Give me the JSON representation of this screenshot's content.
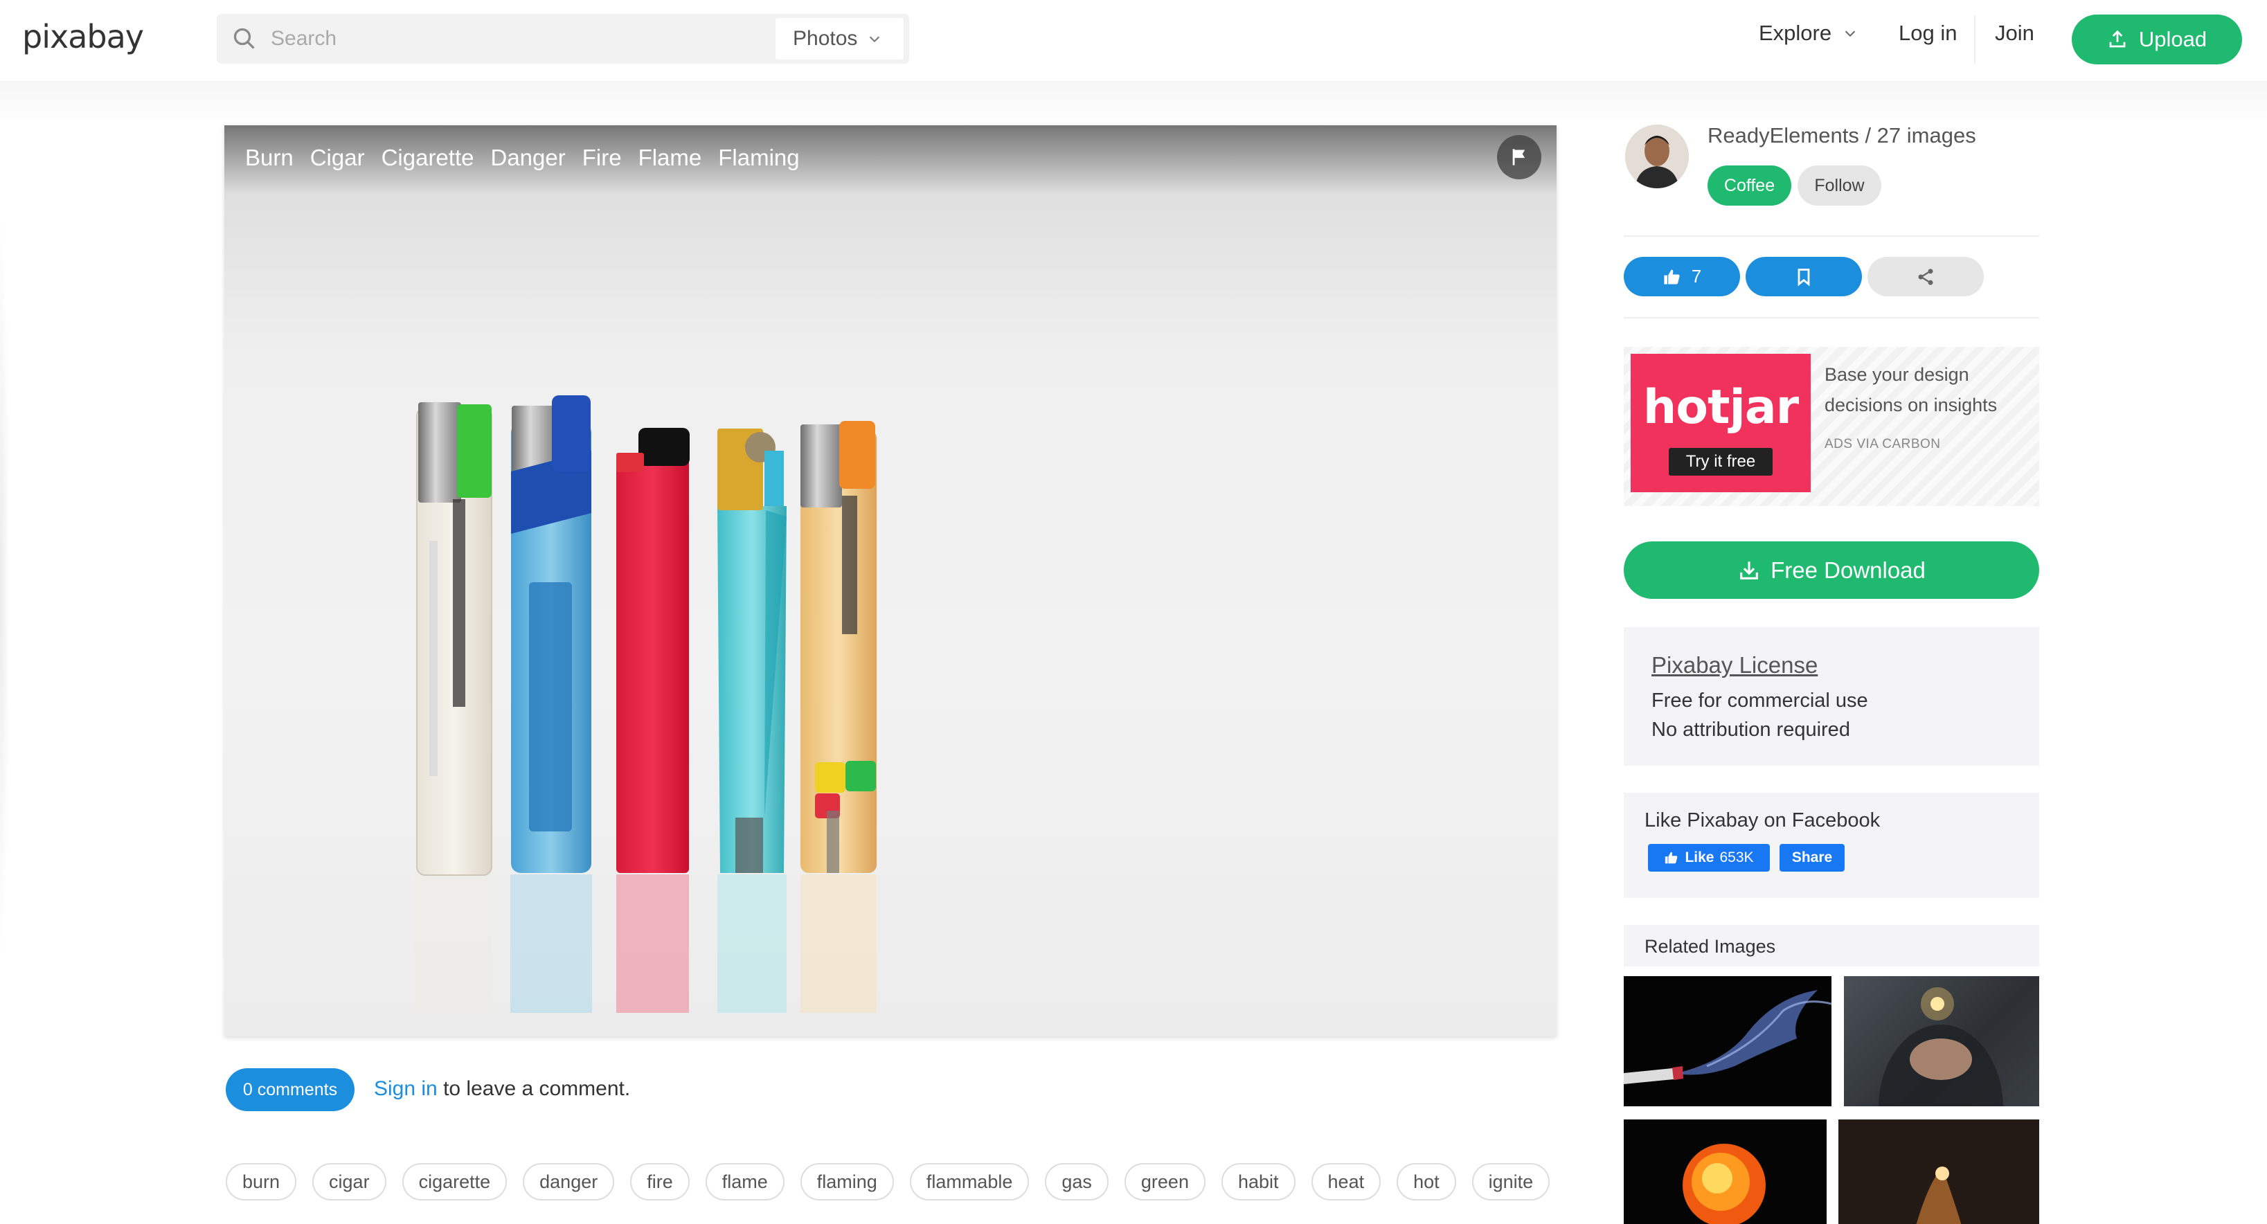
{
  "header": {
    "logo": "pixabay",
    "search_placeholder": "Search",
    "search_type": "Photos",
    "nav": {
      "explore": "Explore",
      "login": "Log in",
      "join": "Join",
      "upload": "Upload"
    }
  },
  "photo": {
    "tags": [
      "Burn",
      "Cigar",
      "Cigarette",
      "Danger",
      "Fire",
      "Flame",
      "Flaming"
    ]
  },
  "comments": {
    "badge": "0 comments",
    "signin": "Sign in",
    "rest": " to leave a comment."
  },
  "tags": [
    "burn",
    "cigar",
    "cigarette",
    "danger",
    "fire",
    "flame",
    "flaming",
    "flammable",
    "gas",
    "green",
    "habit",
    "heat",
    "hot",
    "ignite"
  ],
  "sidebar": {
    "author": "ReadyElements / 27 images",
    "coffee": "Coffee",
    "follow": "Follow",
    "likes": "7",
    "ad": {
      "logo": "hotjar",
      "cta": "Try it free",
      "text": "Base your design decisions on insights",
      "via": "ADS VIA CARBON"
    },
    "download": "Free Download",
    "license": {
      "title": "Pixabay License",
      "line1": "Free for commercial use",
      "line2": "No attribution required"
    },
    "facebook": {
      "title": "Like Pixabay on Facebook",
      "like": "Like",
      "count": "653K",
      "share": "Share"
    },
    "related_title": "Related Images"
  },
  "colors": {
    "accent_green": "#1fba6f",
    "accent_blue": "#1b8ede",
    "facebook_blue": "#1877f2",
    "hotjar_red": "#f0325c"
  },
  "icons": [
    "search-icon",
    "chevron-down-icon",
    "upload-icon",
    "flag-icon",
    "thumbs-up-icon",
    "bookmark-icon",
    "share-icon",
    "download-icon",
    "facebook-thumb-icon"
  ]
}
